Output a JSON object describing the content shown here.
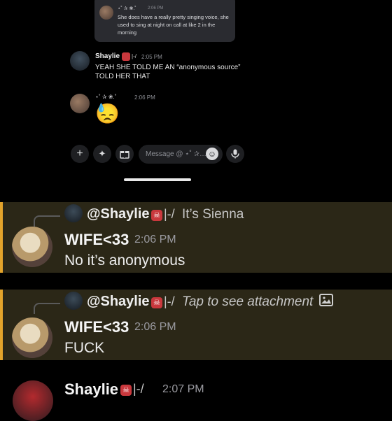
{
  "embed": {
    "name": "⋆˚ ✰ ❀.˚",
    "time": "2:06 PM",
    "text": "She does have a really pretty singing voice, she used to sing at night on call at like 2 in the morning"
  },
  "top_messages": [
    {
      "name": "Shaylie",
      "tag": "|-/",
      "time": "2:05 PM",
      "lines": [
        "YEAH SHE TOLD ME AN “anonymous source”",
        "TOLD HER THAT"
      ]
    },
    {
      "name": "⋆˚ ✰ ❀.˚",
      "time": "2:06 PM",
      "emoji": "😓"
    }
  ],
  "composer": {
    "placeholder": "Message @ ⋆˚ ✰…",
    "icons": [
      "plus-icon",
      "apps-icon",
      "gift-icon",
      "emoji-icon",
      "mic-icon"
    ]
  },
  "replies": [
    {
      "reply_to": "@Shaylie",
      "reply_tag": "|-/",
      "reply_text": "It’s Sienna",
      "author": "WIFE<33",
      "time": "2:06 PM",
      "text": "No it’s anonymous"
    },
    {
      "reply_to": "@Shaylie",
      "reply_tag": "|-/",
      "reply_text": "Tap to see attachment",
      "author": "WIFE<33",
      "time": "2:06 PM",
      "text": "FUCK"
    }
  ],
  "bottom": {
    "name": "Shaylie",
    "tag": "|-/",
    "time": "2:07 PM"
  },
  "colors": {
    "accent": "#e3a32b",
    "highlight": "#2b2717",
    "background": "#000000"
  }
}
